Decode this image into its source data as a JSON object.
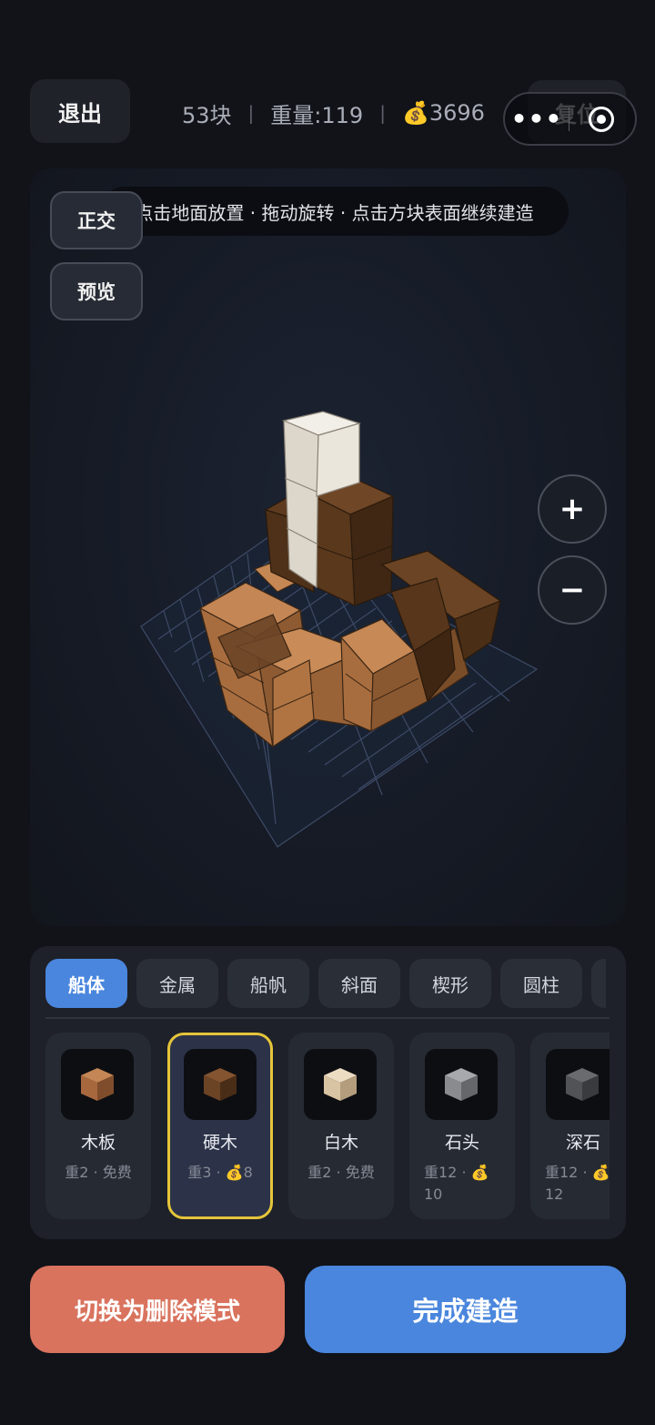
{
  "top_bar": {
    "exit_label": "退出",
    "block_count": "53块",
    "weight": "重量:119",
    "coin_icon": "💰",
    "coins": "3696",
    "separator": "|",
    "reset_label": "复位",
    "capsule_more": "•••"
  },
  "viewport": {
    "hint": "点击地面放置 · 拖动旋转 · 点击方块表面继续建造",
    "ortho_label": "正交",
    "preview_label": "预览",
    "zoom_in": "+",
    "zoom_out": "−"
  },
  "palette": {
    "tabs": [
      {
        "label": "船体",
        "active": true
      },
      {
        "label": "金属",
        "active": false
      },
      {
        "label": "船帆",
        "active": false
      },
      {
        "label": "斜面",
        "active": false
      },
      {
        "label": "楔形",
        "active": false
      },
      {
        "label": "圆柱",
        "active": false
      }
    ],
    "items": [
      {
        "name": "木板",
        "meta": "重2 · 免费",
        "color": "#a8683e",
        "selected": false
      },
      {
        "name": "硬木",
        "meta": "重3 · 💰8",
        "color": "#6b4325",
        "selected": true
      },
      {
        "name": "白木",
        "meta": "重2 · 免费",
        "color": "#d8c3a3",
        "selected": false
      },
      {
        "name": "石头",
        "meta": "重12 · 💰 10",
        "color": "#8a8b8e",
        "selected": false
      },
      {
        "name": "深石",
        "meta": "重12 · 💰 12",
        "color": "#525356",
        "selected": false
      }
    ]
  },
  "actions": {
    "delete_mode": "切换为删除模式",
    "finish": "完成建造"
  }
}
